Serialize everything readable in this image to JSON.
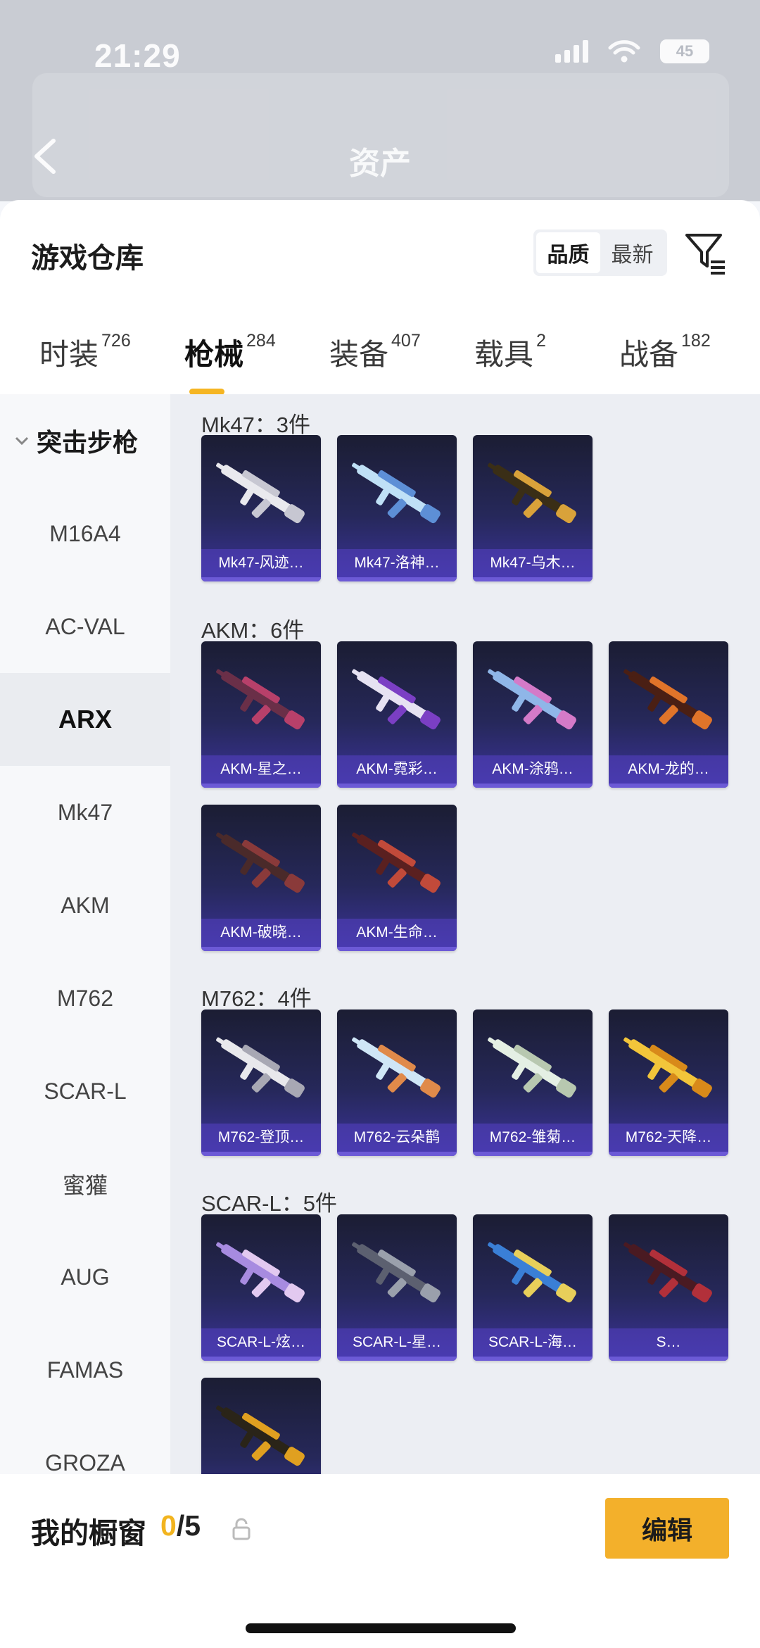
{
  "status_bar": {
    "time": "21:29",
    "battery": "45"
  },
  "header": {
    "title": "资产"
  },
  "sheet": {
    "title": "游戏仓库",
    "sort_options": [
      "品质",
      "最新"
    ]
  },
  "tabs": [
    {
      "label": "时装",
      "count": "726"
    },
    {
      "label": "枪械",
      "count": "284",
      "active": true
    },
    {
      "label": "装备",
      "count": "407"
    },
    {
      "label": "载具",
      "count": "2"
    },
    {
      "label": "战备",
      "count": "182"
    }
  ],
  "sidebar": {
    "group": "突击步枪",
    "items": [
      "M16A4",
      "AC-VAL",
      "ARX",
      "Mk47",
      "AKM",
      "M762",
      "SCAR-L",
      "蜜獾",
      "AUG",
      "FAMAS",
      "GROZA"
    ],
    "active": "ARX"
  },
  "groups": [
    {
      "title": "Mk47：3件",
      "items": [
        "Mk47-风迹…",
        "Mk47-洛神…",
        "Mk47-乌木…"
      ]
    },
    {
      "title": "AKM：6件",
      "items": [
        "AKM-星之…",
        "AKM-霓彩…",
        "AKM-涂鸦…",
        "AKM-龙的…",
        "AKM-破晓…",
        "AKM-生命…"
      ]
    },
    {
      "title": "M762：4件",
      "items": [
        "M762-登顶…",
        "M762-云朵鹊",
        "M762-雏菊…",
        "M762-天降…"
      ]
    },
    {
      "title": "SCAR-L：5件",
      "items": [
        "SCAR-L-炫…",
        "SCAR-L-星…",
        "SCAR-L-海…",
        "S…",
        ""
      ]
    }
  ],
  "showcase": {
    "label": "我的橱窗",
    "current": "0",
    "total": "/5"
  },
  "edit_label": "编辑",
  "colors": {
    "accent": "#f4b22a",
    "card_top": "#1b1d33",
    "card_bottom": "#3b339a"
  }
}
